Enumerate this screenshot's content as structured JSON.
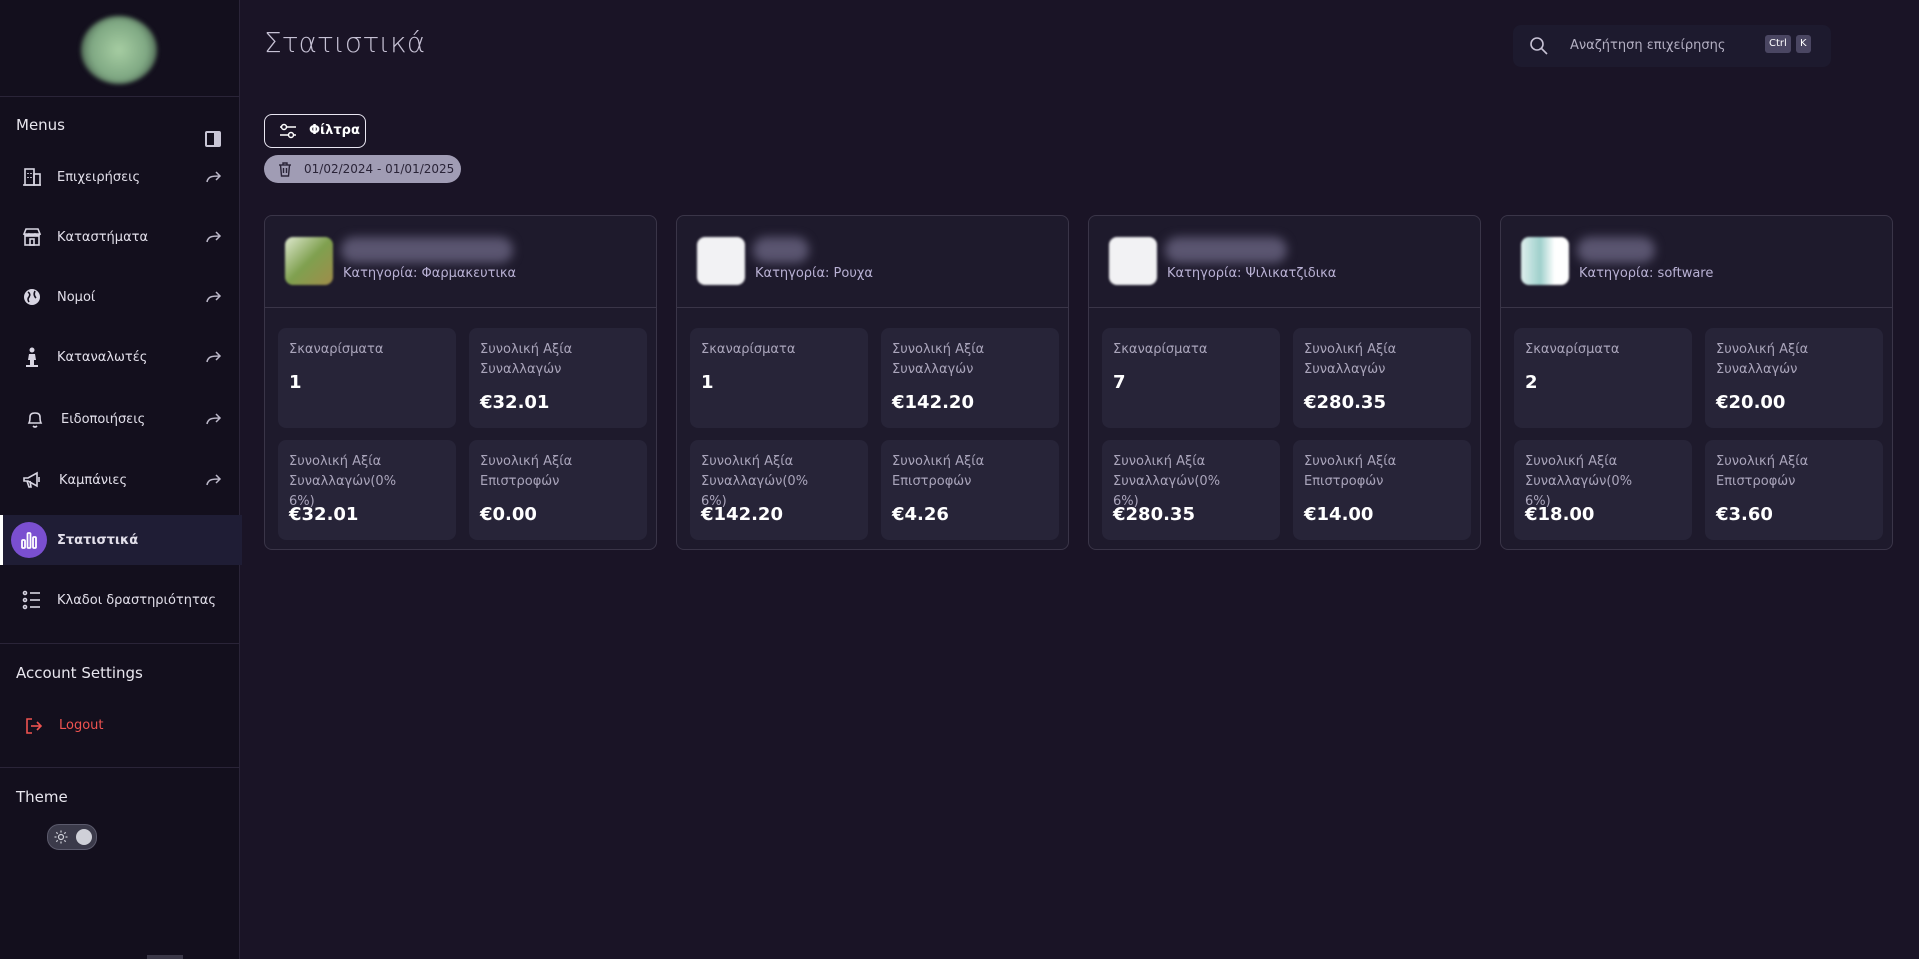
{
  "sidebar": {
    "menus_title": "Menus",
    "items": [
      {
        "label": "Επιχειρήσεις",
        "icon": "building-icon"
      },
      {
        "label": "Καταστήματα",
        "icon": "store-icon"
      },
      {
        "label": "Νομοί",
        "icon": "globe-icon"
      },
      {
        "label": "Καταναλωτές",
        "icon": "person-icon"
      },
      {
        "label": "Ειδοποιήσεις",
        "icon": "bell-icon"
      },
      {
        "label": "Καμπάνιες",
        "icon": "megaphone-icon"
      },
      {
        "label": "Στατιστικά",
        "icon": "bar-chart-icon",
        "active": true
      },
      {
        "label": "Κλαδοι δραστηριότητας",
        "icon": "list-icon"
      }
    ],
    "account_title": "Account Settings",
    "logout_label": "Logout",
    "theme_title": "Theme"
  },
  "header": {
    "title": "Στατιστικά",
    "search_placeholder": "Αναζήτηση επιχείρησης",
    "shortcut_ctrl": "Ctrl",
    "shortcut_key": "K"
  },
  "filters": {
    "button_label": "Φίλτρα",
    "date_range": "01/02/2024 - 01/01/2025"
  },
  "labels": {
    "scans": "Σκαναρίσματα",
    "total_value": "Συνολική Αξία Συναλλαγών",
    "total_value_vat": "Συνολική Αξία Συναλλαγών(0% 6%)",
    "total_returns": "Συνολική Αξία Επιστροφών"
  },
  "cards": [
    {
      "category": "Κατηγορία: Φαρμακευτικα",
      "scans": "1",
      "total_value": "€32.01",
      "total_value_vat": "€32.01",
      "total_returns": "€0.00"
    },
    {
      "category": "Κατηγορία: Ρουχα",
      "scans": "1",
      "total_value": "€142.20",
      "total_value_vat": "€142.20",
      "total_returns": "€4.26"
    },
    {
      "category": "Κατηγορία: Ψιλικατζιδικα",
      "scans": "7",
      "total_value": "€280.35",
      "total_value_vat": "€280.35",
      "total_returns": "€14.00"
    },
    {
      "category": "Κατηγορία: software",
      "scans": "2",
      "total_value": "€20.00",
      "total_value_vat": "€18.00",
      "total_returns": "€3.60"
    }
  ],
  "colors": {
    "background": "#1a1426",
    "sidebar": "#130f1d",
    "active_accent": "#7a4fd0",
    "logout": "#ef5350"
  }
}
